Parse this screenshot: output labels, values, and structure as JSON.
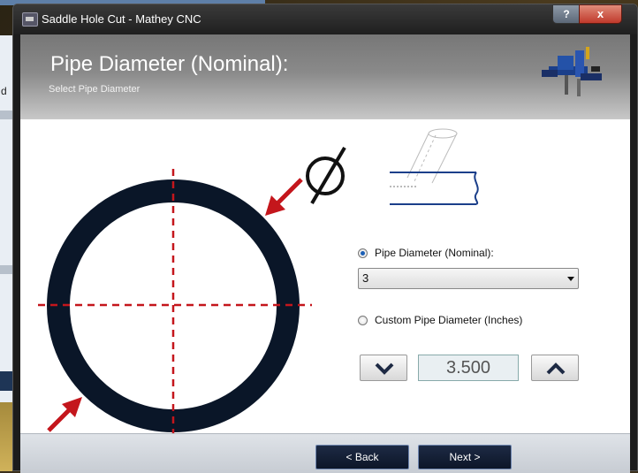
{
  "window": {
    "title": "Saddle Hole Cut - Mathey CNC",
    "help_label": "?",
    "close_label": "x"
  },
  "background": {
    "partial_label": "d"
  },
  "header": {
    "title": "Pipe Diameter (Nominal):",
    "subtitle": "Select Pipe Diameter"
  },
  "diagram": {
    "diameter_symbol": "Ø"
  },
  "form": {
    "nominal_radio_label": "Pipe Diameter (Nominal):",
    "nominal_selected": true,
    "nominal_value": "3",
    "custom_radio_label": "Custom Pipe Diameter  (Inches)",
    "custom_selected": false,
    "custom_value": "3.500"
  },
  "footer": {
    "back_label": "< Back",
    "next_label": "Next >"
  },
  "colors": {
    "pipe_ring": "#0a1628",
    "crosshair": "#c4161c",
    "arrow": "#c4161c",
    "accent": "#1b5fb5"
  }
}
